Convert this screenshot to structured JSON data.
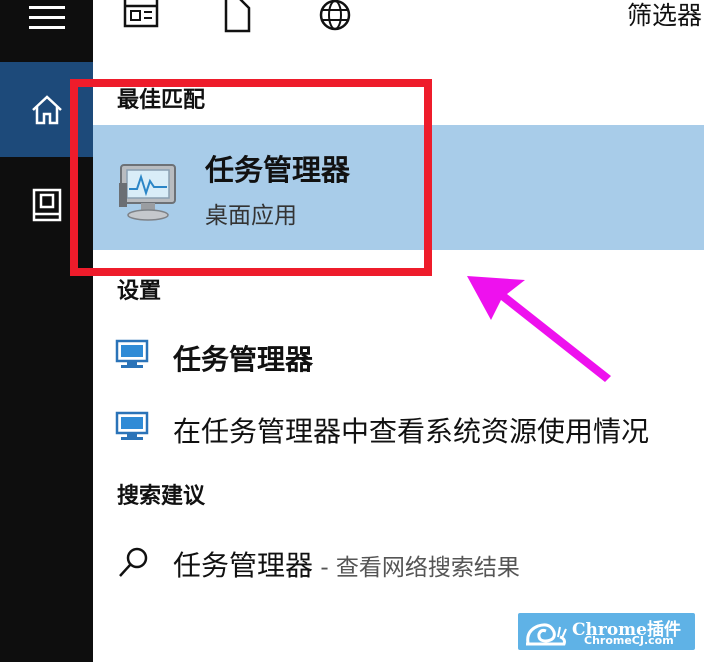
{
  "sidebar": {
    "items": [
      {
        "icon": "hamburger-menu-icon"
      },
      {
        "icon": "home-icon",
        "active": true
      },
      {
        "icon": "documents-icon"
      }
    ]
  },
  "toolbar": {
    "icons": [
      "apps-icon",
      "document-icon",
      "web-globe-icon"
    ],
    "filter_label": "筛选器"
  },
  "sections": {
    "best_match_header": "最佳匹配",
    "settings_header": "设置",
    "suggestions_header": "搜索建议"
  },
  "best_match": {
    "title": "任务管理器",
    "subtitle": "桌面应用"
  },
  "settings_results": [
    {
      "label": "任务管理器"
    },
    {
      "label": "在任务管理器中查看系统资源使用情况"
    }
  ],
  "suggestion": {
    "label": "任务管理器",
    "suffix": " - 查看网络搜索结果"
  },
  "annotation": {
    "box_color": "#ee1c2b",
    "arrow_color": "#ee11ee"
  },
  "watermark": {
    "line1": "Chrome插件",
    "line2": "ChromeCJ.com"
  },
  "colors": {
    "sidebar_bg": "#0e0e0e",
    "sidebar_active": "#1d4a7a",
    "best_match_bg": "#a8cce9"
  }
}
